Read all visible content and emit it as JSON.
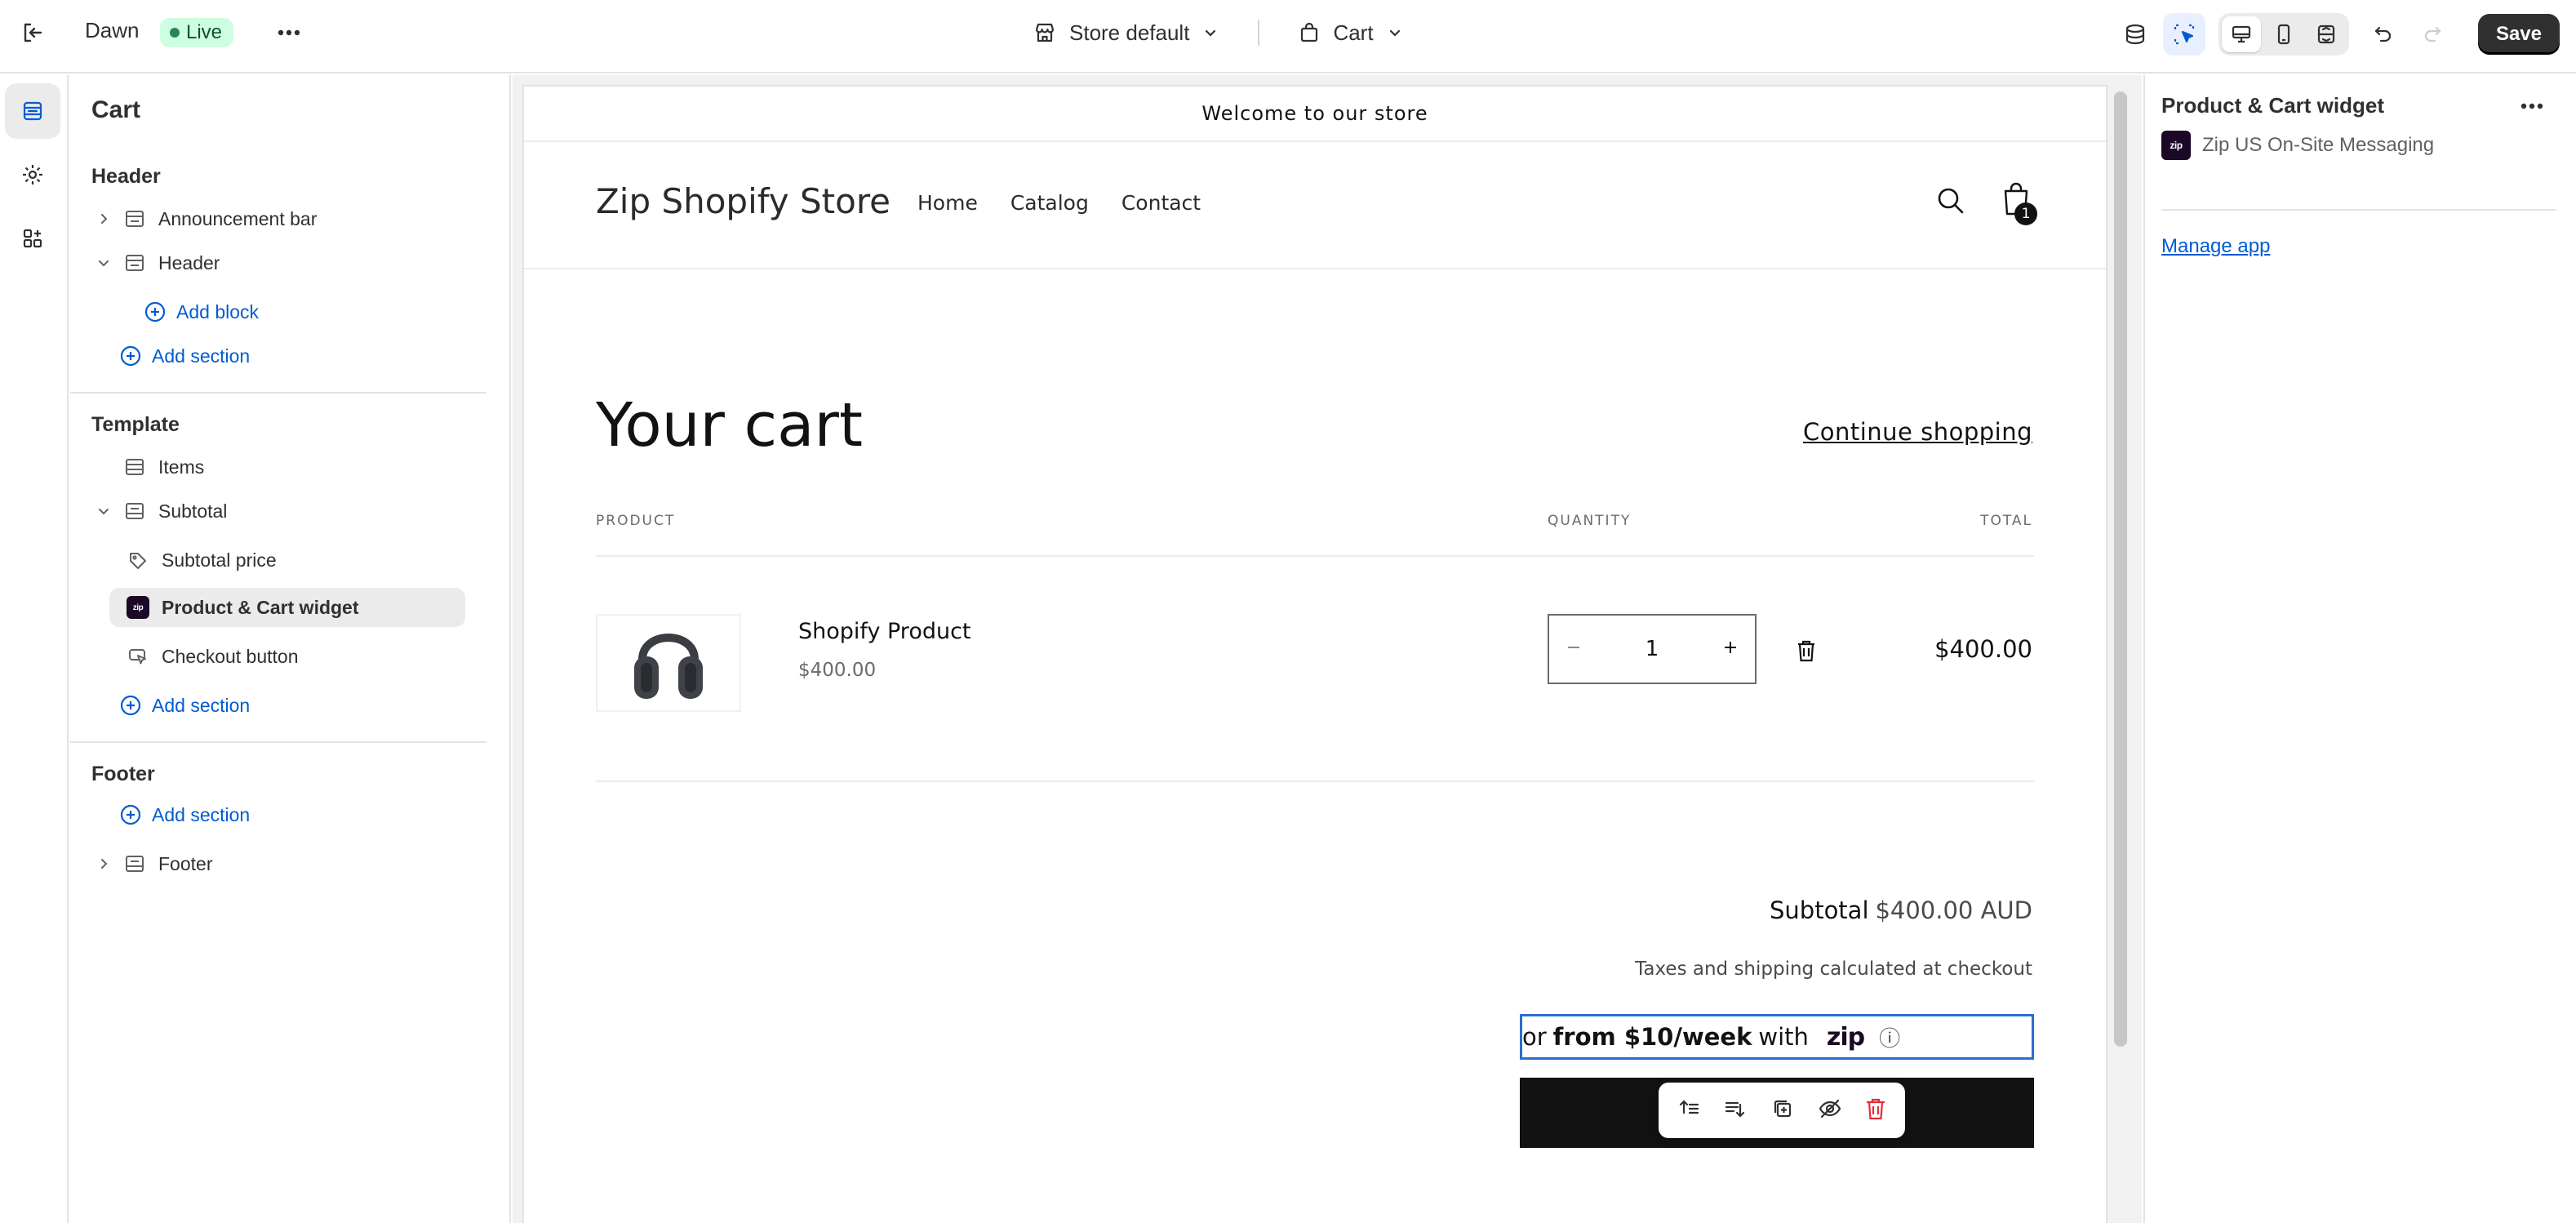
{
  "topbar": {
    "theme_name": "Dawn",
    "status": "Live",
    "store_select": "Store default",
    "template_select": "Cart",
    "save_label": "Save"
  },
  "left_panel": {
    "title": "Cart",
    "header_group": "Header",
    "header_items": [
      "Announcement bar",
      "Header"
    ],
    "add_block": "Add block",
    "add_section_1": "Add section",
    "template_group": "Template",
    "template_items": [
      "Items",
      "Subtotal"
    ],
    "subtotal_blocks": [
      "Subtotal price",
      "Product & Cart widget",
      "Checkout button"
    ],
    "add_section_2": "Add section",
    "footer_group": "Footer",
    "add_section_3": "Add section",
    "footer_items": [
      "Footer"
    ]
  },
  "preview": {
    "announcement": "Welcome to our store",
    "store_name": "Zip Shopify Store",
    "nav": [
      "Home",
      "Catalog",
      "Contact"
    ],
    "cart_count": "1",
    "cart_title": "Your cart",
    "continue_shopping": "Continue shopping",
    "col_product": "PRODUCT",
    "col_quantity": "QUANTITY",
    "col_total": "TOTAL",
    "product_name": "Shopify Product",
    "product_price": "$400.00",
    "quantity": "1",
    "line_total": "$400.00",
    "subtotal_label": "Subtotal",
    "subtotal_value": "$400.00 AUD",
    "taxes_note": "Taxes and shipping calculated at checkout",
    "zip_prefix": "or",
    "zip_amount": "from $10/week",
    "zip_with": "with",
    "zip_logo": "zip",
    "zip_info": "ⓘ"
  },
  "right_panel": {
    "title": "Product & Cart widget",
    "app_name": "Zip US On-Site Messaging",
    "app_badge": "zip",
    "manage_app": "Manage app"
  },
  "colors": {
    "accent_blue": "#005bd3",
    "live_badge_bg": "#cdfee1",
    "selection_outline": "#2c6ecb",
    "zip_purple": "#aa8fff",
    "delete_red": "#e22c38"
  }
}
